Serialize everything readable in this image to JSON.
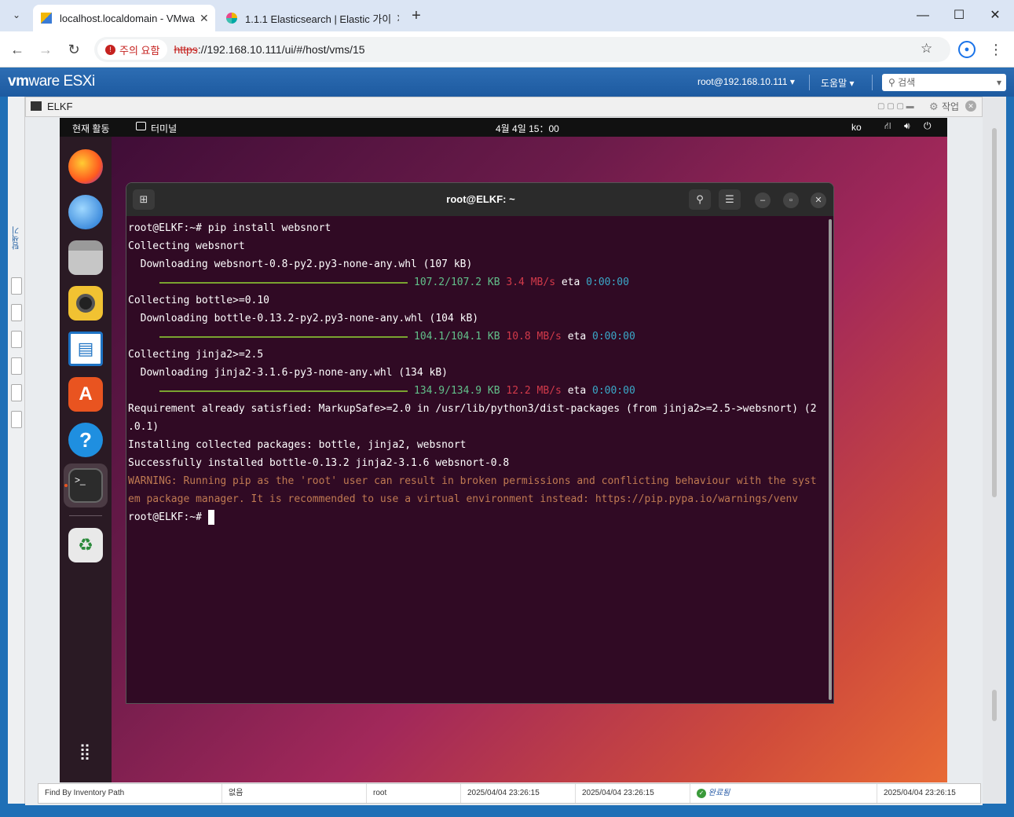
{
  "browser": {
    "tabs": [
      {
        "title": "localhost.localdomain - VMwa"
      },
      {
        "title": "1.1.1 Elasticsearch | Elastic 가이"
      }
    ],
    "new_tab": "+",
    "security": "주의 요함",
    "url_scheme": "https",
    "url_rest": "://192.168.10.111/ui/#/host/vms/15"
  },
  "esxi": {
    "logo_vm": "vm",
    "logo_ware": "ware",
    "logo_esxi": "ESXi",
    "user": "root@192.168.10.111",
    "help": "도움말",
    "search_placeholder": "검색",
    "side_label": "탐색기"
  },
  "console": {
    "vm_name": "ELKF",
    "action": "작업"
  },
  "gnome": {
    "activities": "현재 활동",
    "app": "터미널",
    "clock": "4월 4일  15：00",
    "lang": "ko"
  },
  "terminal": {
    "title": "root@ELKF: ~",
    "lines": {
      "l1": "root@ELKF:~# pip install websnort",
      "l2": "Collecting websnort",
      "l3": "  Downloading websnort-0.8-py2.py3-none-any.whl (107 kB)",
      "p1": {
        "size": "107.2/107.2 KB",
        "speed": "3.4 MB/s",
        "eta": "eta",
        "time": "0:00:00"
      },
      "l4": "Collecting bottle>=0.10",
      "l5": "  Downloading bottle-0.13.2-py2.py3-none-any.whl (104 kB)",
      "p2": {
        "size": "104.1/104.1 KB",
        "speed": "10.8 MB/s",
        "eta": "eta",
        "time": "0:00:00"
      },
      "l6": "Collecting jinja2>=2.5",
      "l7": "  Downloading jinja2-3.1.6-py3-none-any.whl (134 kB)",
      "p3": {
        "size": "134.9/134.9 KB",
        "speed": "12.2 MB/s",
        "eta": "eta",
        "time": "0:00:00"
      },
      "l8": "Requirement already satisfied: MarkupSafe>=2.0 in /usr/lib/python3/dist-packages (from jinja2>=2.5->websnort) (2",
      "l9": ".0.1)",
      "l10": "Installing collected packages: bottle, jinja2, websnort",
      "l11": "Successfully installed bottle-0.13.2 jinja2-3.1.6 websnort-0.8",
      "l12": "WARNING: Running pip as the 'root' user can result in broken permissions and conflicting behaviour with the syst",
      "l13": "em package manager. It is recommended to use a virtual environment instead: https://pip.pypa.io/warnings/venv",
      "l14": "root@ELKF:~# "
    }
  },
  "tasks": {
    "row": [
      "Find By Inventory Path",
      "없음",
      "root",
      "2025/04/04 23:26:15",
      "2025/04/04 23:26:15",
      "완료됨",
      "2025/04/04 23:26:15"
    ]
  },
  "colors": {
    "accent": "#1f6fb6",
    "terminal_bg": "#300a24",
    "progress": "#7aa330"
  }
}
